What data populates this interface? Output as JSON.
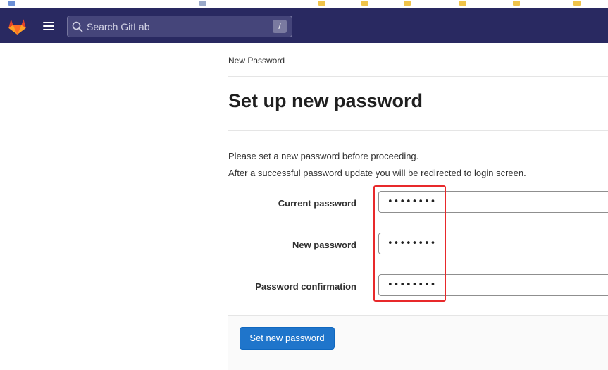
{
  "header": {
    "search_placeholder": "Search GitLab",
    "search_shortcut": "/"
  },
  "breadcrumb": "New Password",
  "page_title": "Set up new password",
  "info": {
    "line1": "Please set a new password before proceeding.",
    "line2": "After a successful password update you will be redirected to login screen."
  },
  "form": {
    "current_password": {
      "label": "Current password",
      "value": "••••••••"
    },
    "new_password": {
      "label": "New password",
      "value": "••••••••"
    },
    "password_confirmation": {
      "label": "Password confirmation",
      "value": "••••••••"
    },
    "submit_label": "Set new password"
  },
  "colors": {
    "navbar": "#292961",
    "primary_button": "#1f75cb",
    "highlight_box": "#e8292b"
  }
}
